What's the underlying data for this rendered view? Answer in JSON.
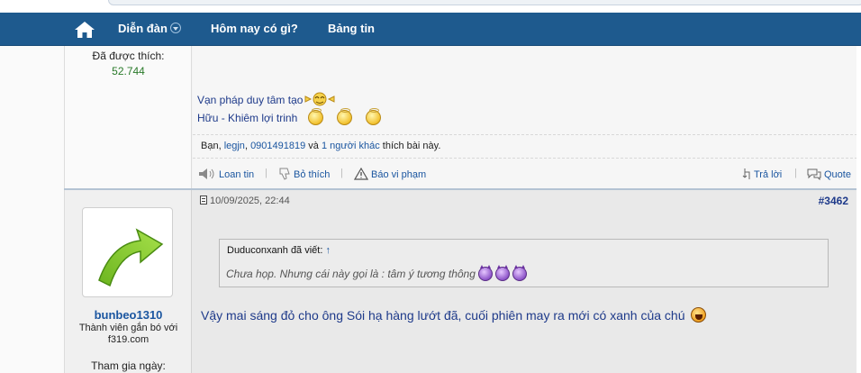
{
  "nav": {
    "forums": "Diễn đàn",
    "today": "Hôm nay có gì?",
    "newsfeed": "Bảng tin"
  },
  "post1": {
    "liked_label": "Đã được thích:",
    "liked_count": "52.744",
    "signature_line1": "Vạn pháp duy tâm tạo",
    "signature_line2": "Hữu - Khiêm lợi trinh",
    "likes": {
      "prefix": "Bạn, ",
      "user1": "legjn",
      "comma": ", ",
      "user2": "0901491819",
      "and": " và ",
      "others": "1 người khác",
      "suffix": " thích bài này."
    },
    "actions": {
      "share": "Loan tin",
      "unlike": "Bỏ thích",
      "report": "Báo vi phạm",
      "reply": "Trả lời",
      "quote": "Quote"
    }
  },
  "post2": {
    "username": "bunbeo1310",
    "user_title": "Thành viên gắn bó với f319.com",
    "joined_label": "Tham gia ngày:",
    "date": "10/09/2025, 22:44",
    "post_number": "#3462",
    "quote": {
      "author": "Duduconxanh đã viết:",
      "arrow": "↑",
      "text": "Chưa họp. Nhưng cái này gọi là : tâm ý tương thông"
    },
    "message": "Vậy mai sáng đỏ cho ông Sói hạ hàng lướt đã, cuối phiên may ra mới có xanh của chú"
  },
  "colors": {
    "navbar": "#1e5a8e",
    "link": "#1b56a0",
    "signature_text": "#1e3a8a",
    "liked_count": "#2a7a2a"
  }
}
